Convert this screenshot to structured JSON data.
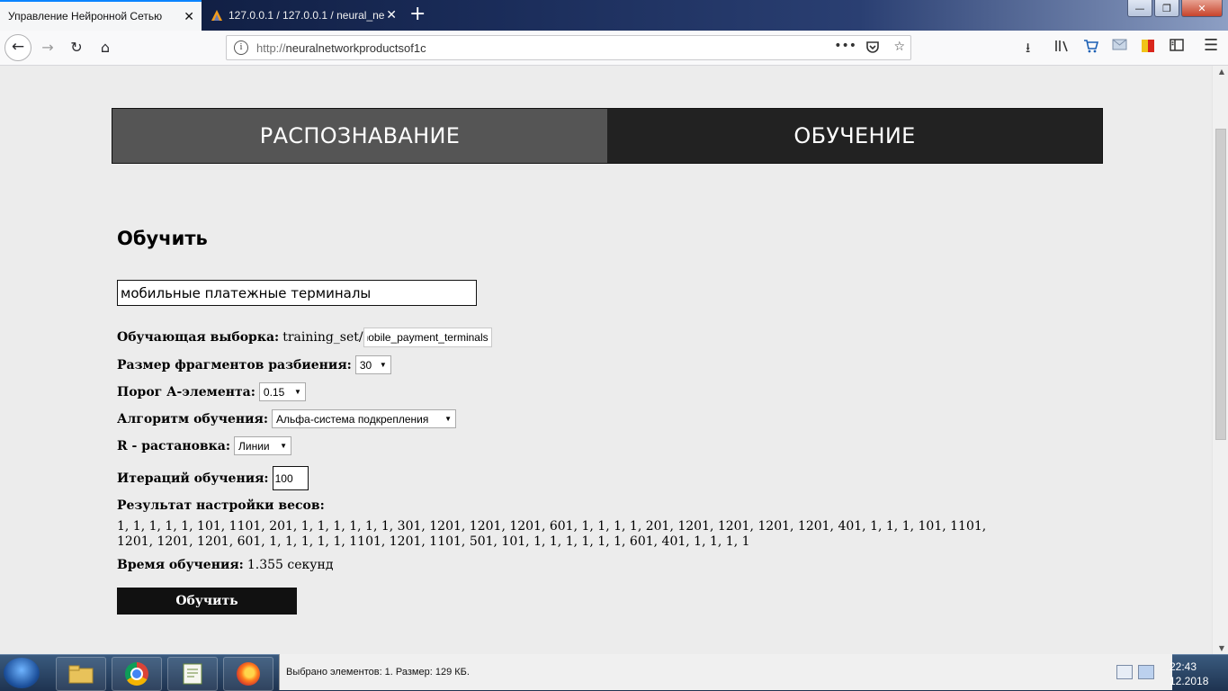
{
  "browser": {
    "tabs": [
      {
        "title": "Управление Нейронной Сетью",
        "active": true
      },
      {
        "title": "127.0.0.1 / 127.0.0.1 / neural_ne",
        "active": false
      }
    ],
    "new_tab": "+",
    "window_controls": {
      "minimize": "—",
      "maximize": "❐",
      "close": "✕"
    },
    "url": "http://neuralnetworkproductsof1c",
    "url_scheme": "http://",
    "url_host": "neuralnetworkproductsof1c",
    "page_actions": "•••"
  },
  "menu": {
    "recognize": "РАСПОЗНАВАНИЕ",
    "train": "ОБУЧЕНИЕ"
  },
  "page": {
    "title": "Обучить",
    "class_input_value": "мобильные платежные терминалы",
    "training_set": {
      "label": "Обучающая выборка:",
      "prefix": "training_set/",
      "value": "mobile_payment_terminals",
      "visible_value": "bile_payment_terminals"
    },
    "fragment_size": {
      "label": "Размер фрагментов разбиения:",
      "value": "30"
    },
    "threshold": {
      "label": "Порог А-элемента:",
      "value": "0.15"
    },
    "algorithm": {
      "label": "Алгоритм обучения:",
      "value": "Альфа-система подкрепления"
    },
    "r_layout": {
      "label": "R - растановка:",
      "value": "Линии"
    },
    "iterations": {
      "label": "Итераций обучения:",
      "value": "100"
    },
    "weights": {
      "label": "Результат настройки весов:",
      "value": "1, 1, 1, 1, 1, 101, 1101, 201, 1, 1, 1, 1, 1, 1, 301, 1201, 1201, 1201, 601, 1, 1, 1, 1, 201, 1201, 1201, 1201, 1201, 401, 1, 1, 1, 101, 1101, 1201, 1201, 1201, 601, 1, 1, 1, 1, 1, 1101, 1201, 1101, 501, 101, 1, 1, 1, 1, 1, 1, 601, 401, 1, 1, 1, 1"
    },
    "train_time": {
      "label": "Время обучения:",
      "value": "1.355 секунд"
    },
    "train_button": "Обучить"
  },
  "taskbar": {
    "explorer_status": "Выбрано элементов: 1. Размер: 129 КБ.",
    "clock_time": "22:43",
    "clock_date": "12.2018"
  }
}
